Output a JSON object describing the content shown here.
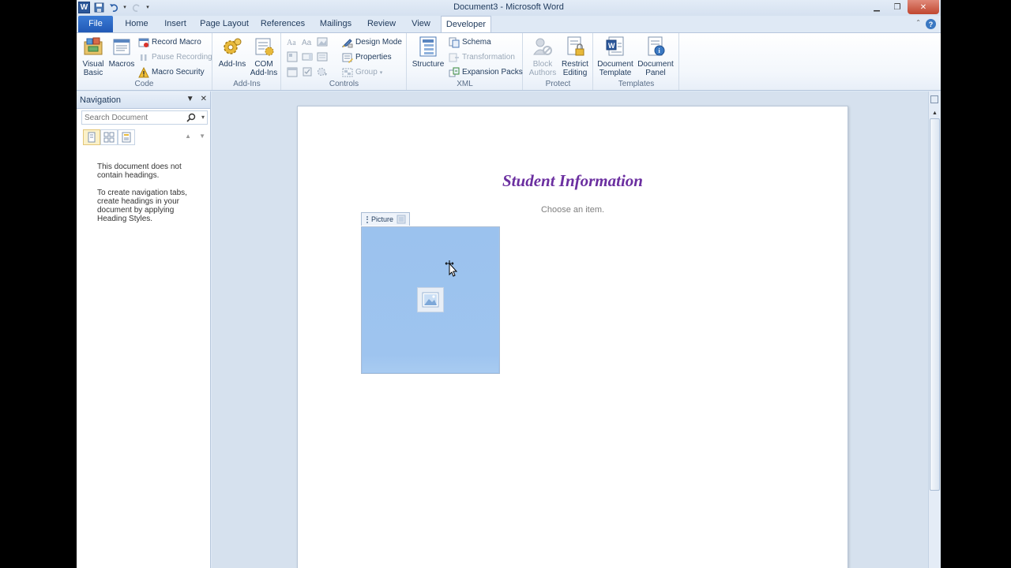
{
  "window": {
    "title": "Document3 - Microsoft Word",
    "app_letter": "W"
  },
  "tabs": [
    "File",
    "Home",
    "Insert",
    "Page Layout",
    "References",
    "Mailings",
    "Review",
    "View",
    "Developer"
  ],
  "active_tab": "Developer",
  "ribbon": {
    "code": {
      "label": "Code",
      "visual_basic": "Visual Basic",
      "macros": "Macros",
      "record_macro": "Record Macro",
      "pause_recording": "Pause Recording",
      "macro_security": "Macro Security"
    },
    "addins": {
      "label": "Add-Ins",
      "add_ins": "Add-Ins",
      "com_add_ins": "COM Add-Ins"
    },
    "controls": {
      "label": "Controls",
      "design_mode": "Design Mode",
      "properties": "Properties",
      "group": "Group"
    },
    "xml": {
      "label": "XML",
      "structure": "Structure",
      "schema": "Schema",
      "transformation": "Transformation",
      "expansion_packs": "Expansion Packs"
    },
    "protect": {
      "label": "Protect",
      "block_authors": "Block Authors",
      "restrict_editing": "Restrict Editing"
    },
    "templates": {
      "label": "Templates",
      "document_template": "Document Template",
      "document_panel": "Document Panel"
    }
  },
  "navigation": {
    "title": "Navigation",
    "search_placeholder": "Search Document",
    "message_1": "This document does not contain headings.",
    "message_2": "To create navigation tabs, create headings in your document by applying Heading Styles."
  },
  "document": {
    "title": "Student Information",
    "dropdown_placeholder": "Choose an item.",
    "picture_control_label": "Picture"
  },
  "colors": {
    "title_purple": "#6b2fa0",
    "picture_fill": "#9ec4ef",
    "file_tab": "#2b62c0"
  }
}
